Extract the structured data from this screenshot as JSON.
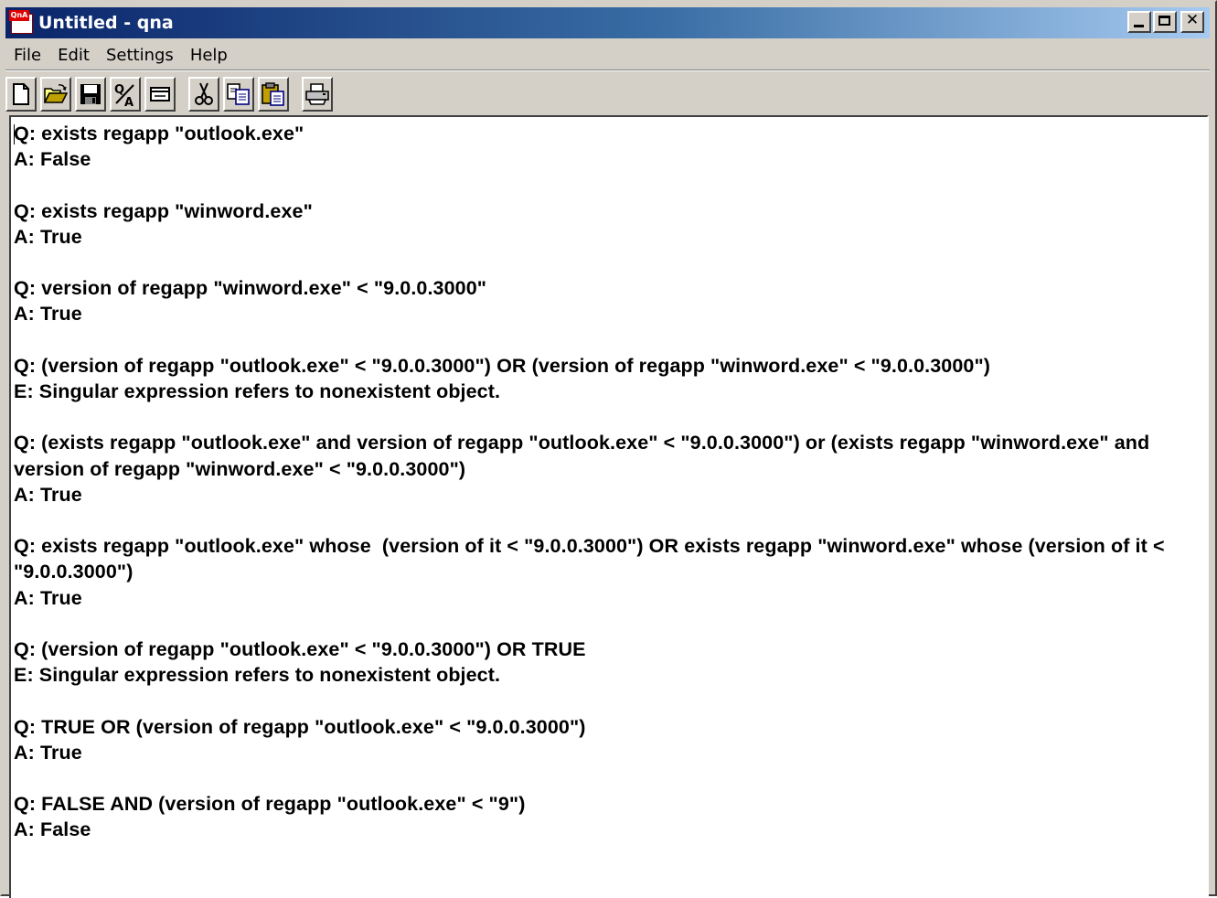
{
  "window": {
    "title": "Untitled - qna",
    "app_icon": "qna-app-icon",
    "app_icon_text": "QnA",
    "buttons": {
      "minimize": "minimize-icon",
      "maximize": "maximize-icon",
      "close": "close-icon",
      "close_glyph": "✕"
    }
  },
  "menu": {
    "items": [
      "File",
      "Edit",
      "Settings",
      "Help"
    ]
  },
  "toolbar": {
    "buttons": [
      "new-document-icon",
      "open-folder-icon",
      "save-icon",
      "evaluate-qa-icon",
      "window-icon",
      "cut-icon",
      "copy-icon",
      "paste-icon",
      "print-icon"
    ]
  },
  "editor": {
    "content": "Q: exists regapp \"outlook.exe\"\nA: False\n\nQ: exists regapp \"winword.exe\"\nA: True\n\nQ: version of regapp \"winword.exe\" < \"9.0.0.3000\"\nA: True\n\nQ: (version of regapp \"outlook.exe\" < \"9.0.0.3000\") OR (version of regapp \"winword.exe\" < \"9.0.0.3000\")\nE: Singular expression refers to nonexistent object.\n\nQ: (exists regapp \"outlook.exe\" and version of regapp \"outlook.exe\" < \"9.0.0.3000\") or (exists regapp \"winword.exe\" and version of regapp \"winword.exe\" < \"9.0.0.3000\")\nA: True\n\nQ: exists regapp \"outlook.exe\" whose  (version of it < \"9.0.0.3000\") OR exists regapp \"winword.exe\" whose (version of it < \"9.0.0.3000\")\nA: True\n\nQ: (version of regapp \"outlook.exe\" < \"9.0.0.3000\") OR TRUE\nE: Singular expression refers to nonexistent object.\n\nQ: TRUE OR (version of regapp \"outlook.exe\" < \"9.0.0.3000\")\nA: True\n\nQ: FALSE AND (version of regapp \"outlook.exe\" < \"9\")\nA: False"
  },
  "colors": {
    "title_gradient_start": "#0a246a",
    "title_gradient_end": "#a6caf0",
    "chrome": "#d4d0c8"
  }
}
